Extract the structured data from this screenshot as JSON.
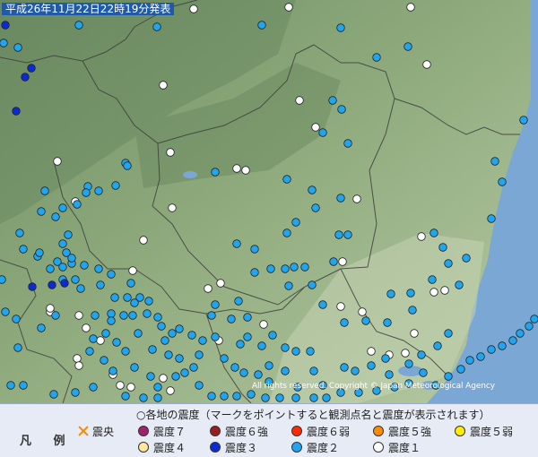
{
  "header": {
    "timestamp": "平成26年11月22日22時19分発表"
  },
  "copyright": "All rights reserved. Copyright © Japan Meteorological Agency",
  "legend": {
    "title": "凡 例",
    "note": "○各地の震度（マークをポイントすると観測点名と震度が表示されます）",
    "epicenter": {
      "label": "震央",
      "color": "#f08c00"
    },
    "items": [
      {
        "label": "震度７",
        "color": "#a0226e"
      },
      {
        "label": "震度６強",
        "color": "#9b1e1e"
      },
      {
        "label": "震度６弱",
        "color": "#ff2a00"
      },
      {
        "label": "震度５強",
        "color": "#ff8c00"
      },
      {
        "label": "震度５弱",
        "color": "#ffee00"
      },
      {
        "label": "震度４",
        "color": "#ffe7a0"
      },
      {
        "label": "震度３",
        "color": "#0a2ad6"
      },
      {
        "label": "震度２",
        "color": "#1fa6f0"
      },
      {
        "label": "震度１",
        "color": "#ffffff"
      }
    ]
  },
  "colors": {
    "sea": "#7aa7d4",
    "land_high": "#7f9e73",
    "land_low": "#b8c9a8",
    "border": "#4a4a4a"
  },
  "observation_points": {
    "shindo3": [
      [
        6,
        28
      ],
      [
        35,
        76
      ],
      [
        28,
        86
      ],
      [
        18,
        124
      ],
      [
        36,
        320
      ],
      [
        58,
        318
      ],
      [
        72,
        316
      ]
    ],
    "shindo2": [
      [
        4,
        48
      ],
      [
        20,
        53
      ],
      [
        88,
        28
      ],
      [
        156,
        10
      ],
      [
        175,
        30
      ],
      [
        292,
        28
      ],
      [
        380,
        31
      ],
      [
        420,
        64
      ],
      [
        455,
        52
      ],
      [
        371,
        112
      ],
      [
        381,
        122
      ],
      [
        360,
        148
      ],
      [
        388,
        160
      ],
      [
        140,
        182
      ],
      [
        142,
        185
      ],
      [
        240,
        192
      ],
      [
        98,
        208
      ],
      [
        110,
        213
      ],
      [
        129,
        207
      ],
      [
        86,
        228
      ],
      [
        96,
        215
      ],
      [
        50,
        213
      ],
      [
        70,
        232
      ],
      [
        46,
        236
      ],
      [
        320,
        200
      ],
      [
        348,
        212
      ],
      [
        352,
        232
      ],
      [
        380,
        221
      ],
      [
        330,
        248
      ],
      [
        378,
        262
      ],
      [
        388,
        262
      ],
      [
        320,
        260
      ],
      [
        264,
        272
      ],
      [
        284,
        278
      ],
      [
        284,
        304
      ],
      [
        302,
        300
      ],
      [
        318,
        300
      ],
      [
        328,
        298
      ],
      [
        340,
        298
      ],
      [
        348,
        318
      ],
      [
        322,
        319
      ],
      [
        360,
        340
      ],
      [
        372,
        292
      ],
      [
        384,
        360
      ],
      [
        408,
        358
      ],
      [
        432,
        360
      ],
      [
        458,
        327
      ],
      [
        482,
        312
      ],
      [
        512,
        318
      ],
      [
        500,
        294
      ],
      [
        520,
        288
      ],
      [
        494,
        276
      ],
      [
        484,
        260
      ],
      [
        552,
        180
      ],
      [
        560,
        203
      ],
      [
        548,
        244
      ],
      [
        584,
        134
      ],
      [
        22,
        260
      ],
      [
        26,
        278
      ],
      [
        42,
        286
      ],
      [
        64,
        292
      ],
      [
        70,
        298
      ],
      [
        80,
        294
      ],
      [
        94,
        296
      ],
      [
        84,
        312
      ],
      [
        90,
        322
      ],
      [
        110,
        300
      ],
      [
        112,
        318
      ],
      [
        124,
        306
      ],
      [
        128,
        332
      ],
      [
        146,
        316
      ],
      [
        142,
        332
      ],
      [
        156,
        332
      ],
      [
        166,
        336
      ],
      [
        70,
        312
      ],
      [
        2,
        312
      ],
      [
        6,
        348
      ],
      [
        18,
        356
      ],
      [
        62,
        352
      ],
      [
        46,
        366
      ],
      [
        20,
        388
      ],
      [
        106,
        352
      ],
      [
        124,
        350
      ],
      [
        124,
        358
      ],
      [
        138,
        352
      ],
      [
        148,
        352
      ],
      [
        164,
        350
      ],
      [
        176,
        354
      ],
      [
        180,
        364
      ],
      [
        192,
        372
      ],
      [
        200,
        367
      ],
      [
        214,
        374
      ],
      [
        226,
        380
      ],
      [
        222,
        396
      ],
      [
        216,
        410
      ],
      [
        236,
        352
      ],
      [
        240,
        376
      ],
      [
        258,
        356
      ],
      [
        276,
        354
      ],
      [
        276,
        376
      ],
      [
        268,
        384
      ],
      [
        292,
        386
      ],
      [
        304,
        374
      ],
      [
        300,
        408
      ],
      [
        318,
        388
      ],
      [
        330,
        392
      ],
      [
        346,
        392
      ],
      [
        350,
        414
      ],
      [
        360,
        430
      ],
      [
        384,
        410
      ],
      [
        396,
        414
      ],
      [
        414,
        408
      ],
      [
        430,
        400
      ],
      [
        434,
        418
      ],
      [
        456,
        406
      ],
      [
        470,
        396
      ],
      [
        488,
        386
      ],
      [
        500,
        372
      ],
      [
        460,
        346
      ],
      [
        436,
        328
      ],
      [
        240,
        340
      ],
      [
        266,
        336
      ],
      [
        250,
        400
      ],
      [
        262,
        410
      ],
      [
        272,
        416
      ],
      [
        288,
        418
      ],
      [
        300,
        426
      ],
      [
        318,
        414
      ],
      [
        332,
        432
      ],
      [
        100,
        392
      ],
      [
        116,
        402
      ],
      [
        126,
        414
      ],
      [
        150,
        410
      ],
      [
        168,
        420
      ],
      [
        176,
        432
      ],
      [
        196,
        420
      ],
      [
        206,
        416
      ],
      [
        222,
        430
      ],
      [
        236,
        442
      ],
      [
        250,
        442
      ],
      [
        264,
        442
      ],
      [
        280,
        440
      ],
      [
        296,
        444
      ],
      [
        312,
        444
      ],
      [
        330,
        444
      ],
      [
        350,
        444
      ],
      [
        364,
        444
      ],
      [
        380,
        438
      ],
      [
        400,
        438
      ],
      [
        420,
        436
      ],
      [
        440,
        432
      ],
      [
        456,
        428
      ],
      [
        472,
        416
      ],
      [
        486,
        430
      ],
      [
        500,
        420
      ],
      [
        514,
        412
      ],
      [
        524,
        402
      ],
      [
        536,
        398
      ],
      [
        548,
        390
      ],
      [
        560,
        386
      ],
      [
        572,
        380
      ],
      [
        580,
        372
      ],
      [
        590,
        364
      ],
      [
        596,
        356
      ],
      [
        70,
        272
      ],
      [
        76,
        262
      ],
      [
        62,
        242
      ],
      [
        44,
        282
      ],
      [
        74,
        282
      ],
      [
        80,
        288
      ],
      [
        56,
        300
      ],
      [
        150,
        338
      ],
      [
        130,
        382
      ],
      [
        140,
        392
      ],
      [
        170,
        390
      ],
      [
        188,
        396
      ],
      [
        200,
        400
      ],
      [
        12,
        430
      ],
      [
        26,
        430
      ],
      [
        60,
        440
      ],
      [
        84,
        438
      ],
      [
        104,
        432
      ],
      [
        140,
        442
      ],
      [
        160,
        444
      ],
      [
        176,
        444
      ],
      [
        184,
        380
      ],
      [
        154,
        372
      ],
      [
        118,
        372
      ],
      [
        104,
        378
      ]
    ],
    "shindo1": [
      [
        216,
        10
      ],
      [
        322,
        8
      ],
      [
        458,
        8
      ],
      [
        476,
        72
      ],
      [
        182,
        95
      ],
      [
        334,
        112
      ],
      [
        352,
        142
      ],
      [
        190,
        170
      ],
      [
        264,
        188
      ],
      [
        274,
        190
      ],
      [
        192,
        232
      ],
      [
        84,
        225
      ],
      [
        160,
        268
      ],
      [
        382,
        292
      ],
      [
        398,
        222
      ],
      [
        470,
        264
      ],
      [
        484,
        326
      ],
      [
        496,
        324
      ],
      [
        246,
        316
      ],
      [
        232,
        322
      ],
      [
        148,
        302
      ],
      [
        380,
        342
      ],
      [
        404,
        348
      ],
      [
        462,
        372
      ],
      [
        452,
        394
      ],
      [
        414,
        392
      ],
      [
        434,
        396
      ],
      [
        244,
        380
      ],
      [
        294,
        362
      ],
      [
        88,
        352
      ],
      [
        96,
        366
      ],
      [
        56,
        348
      ],
      [
        56,
        344
      ],
      [
        112,
        380
      ],
      [
        86,
        400
      ],
      [
        88,
        408
      ],
      [
        182,
        422
      ],
      [
        190,
        436
      ],
      [
        126,
        418
      ],
      [
        134,
        430
      ],
      [
        146,
        432
      ],
      [
        64,
        180
      ],
      [
        58,
        12
      ]
    ]
  }
}
